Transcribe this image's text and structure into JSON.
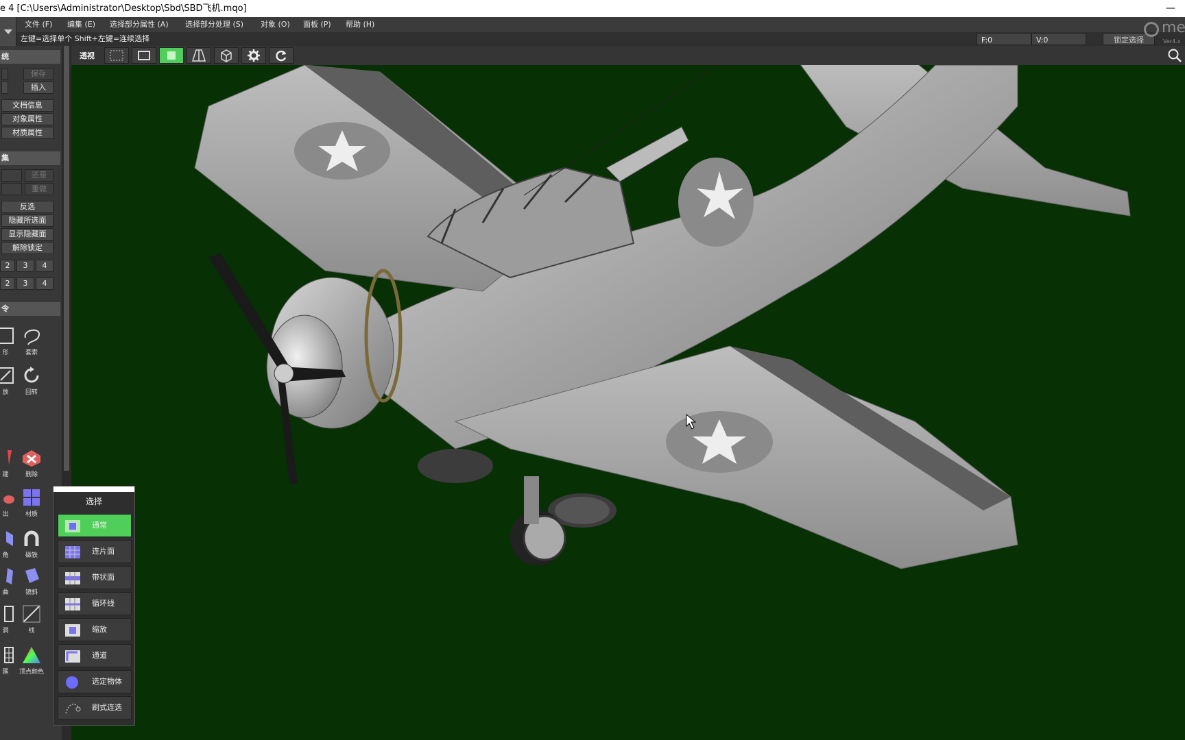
{
  "window": {
    "title": "e 4 [C:\\Users\\Administrator\\Desktop\\Sbd\\SBD飞机.mqo]",
    "minimize": "—"
  },
  "menu": [
    "文件 (F)",
    "编集 (E)",
    "选择部分属性 (A)",
    "选择部分处理 (S)",
    "对象 (O)",
    "面板 (P)",
    "帮助 (H)"
  ],
  "status": {
    "hint": "左键=选择单个  Shift+左键=连续选择",
    "face_count": "F:0",
    "vertex_count": "V:0",
    "lock_select": "锁定选择"
  },
  "logo": {
    "text": "met",
    "version": "Ver4.x"
  },
  "toolbar": {
    "view_label": "透视",
    "active_tool": "face-select"
  },
  "left_panel": {
    "system_header": "统",
    "save": "保存",
    "insert": "插入",
    "doc_info": "文档信息",
    "object_props": "对象属性",
    "material_props": "材质属性",
    "edit_header": "集",
    "undo": "还原",
    "redo": "重做",
    "invert": "反选",
    "hide_selected": "隐藏所选面",
    "show_hidden": "显示隐藏面",
    "unlock": "解除锁定",
    "num_row1": [
      "2",
      "3",
      "4"
    ],
    "num_row2": [
      "2",
      "3",
      "4"
    ],
    "command_header": "令",
    "tools": {
      "rect": "形",
      "lasso": "套索",
      "scale": "放",
      "rotate": "回转",
      "create": "建",
      "delete": "删除",
      "extrude": "出",
      "material": "材质",
      "angle": "角",
      "magnet": "磁铁",
      "bend": "曲",
      "twist": "镜斜",
      "hole": "洞",
      "line": "线",
      "grid": "匯",
      "vertex_color": "顶点颜色"
    }
  },
  "select_popup": {
    "title": "选择",
    "items": [
      "通常",
      "连片面",
      "带状面",
      "循环线",
      "缩放",
      "通道",
      "选定物体",
      "刷式连选"
    ]
  },
  "colors": {
    "viewport_bg": "#073004",
    "active_green": "#4fcf5a",
    "panel_bg": "#383838"
  }
}
